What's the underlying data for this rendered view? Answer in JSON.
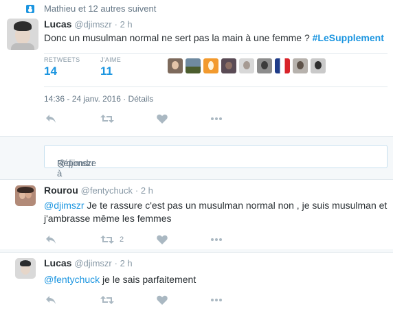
{
  "context": {
    "text": "Mathieu et 12 autres suivent"
  },
  "main_tweet": {
    "name": "Lucas",
    "handle": "@djimszr",
    "time": "· 2 h",
    "text_plain": "Donc un musulman normal ne sert pas la main à une femme ? ",
    "hashtag": "#LeSupplement",
    "retweets_label": "RETWEETS",
    "retweets": "14",
    "likes_label": "J'AIME",
    "likes": "11",
    "timestamp": "14:36 - 24 janv. 2016 · Détails"
  },
  "reply_box": {
    "placeholder": "Répondre à ",
    "mention": "@djimszr"
  },
  "replies": [
    {
      "name": "Rourou",
      "handle": "@fentychuck",
      "time": "· 2 h",
      "mention": "@djimszr",
      "text": " Je te rassure c'est pas un musulman normal non , je suis musulman et j'ambrasse même les femmes",
      "retweet_count": "2"
    },
    {
      "name": "Lucas",
      "handle": "@djimszr",
      "time": "· 2 h",
      "mention": "@fentychuck",
      "text": " je le sais parfaitement"
    }
  ],
  "icons": {
    "reply": "reply-icon",
    "retweet": "retweet-icon",
    "like": "heart-icon",
    "more": "more-icon"
  },
  "colors": {
    "accent": "#1b95e0",
    "muted": "#8899a6",
    "background": "#f5f8fa"
  }
}
